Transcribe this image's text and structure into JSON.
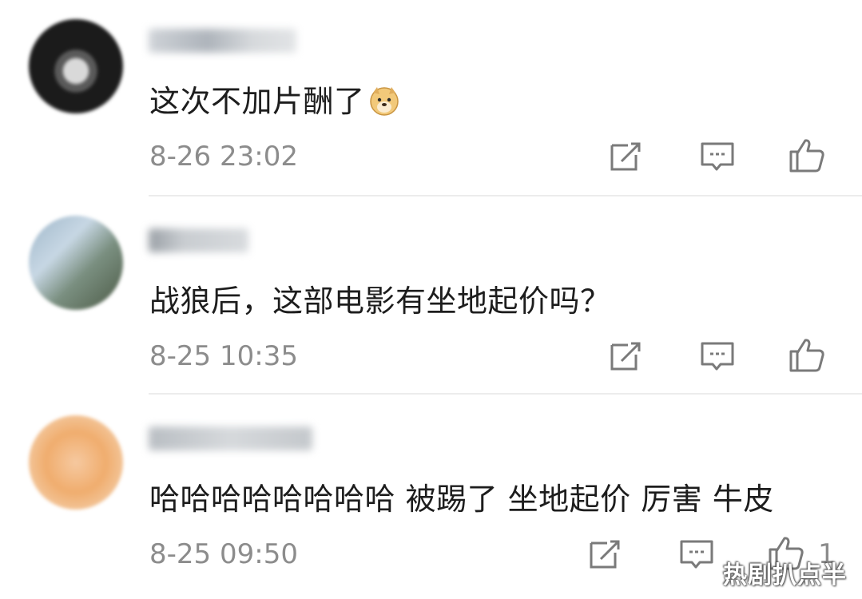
{
  "comments": [
    {
      "text": "这次不加片酬了",
      "emoji": "doge-emoji",
      "time": "8-26 23:02",
      "like_count": "",
      "avatar_color": "#2a2a2a"
    },
    {
      "text": "战狼后，这部电影有坐地起价吗？",
      "time": "8-25 10:35",
      "like_count": "",
      "avatar_color": "#8aa3b8"
    },
    {
      "text": "哈哈哈哈哈哈哈哈 被踢了 坐地起价 厉害 牛皮",
      "time": "8-25 09:50",
      "like_count": "1",
      "avatar_color": "#f0b27a"
    }
  ],
  "icons": {
    "repost": "repost-icon",
    "comment": "comment-icon",
    "like": "thumbs-up-icon"
  },
  "watermark": "热剧扒点半",
  "colors": {
    "text": "#1d1d1d",
    "meta": "#8c8c8c",
    "icon": "#7a7a7a",
    "divider": "#ececec"
  }
}
